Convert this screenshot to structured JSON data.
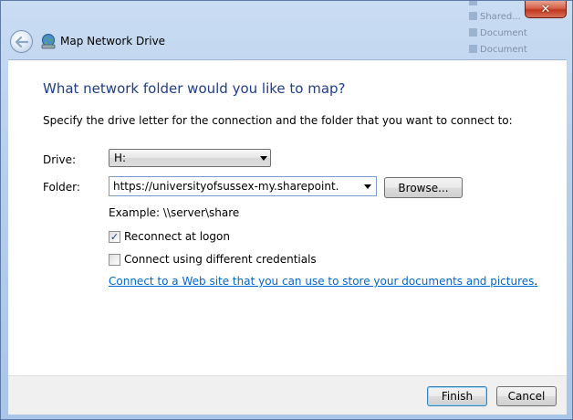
{
  "window": {
    "title": "Map Network Drive",
    "close_glyph": "✕"
  },
  "background_items": [
    "",
    "Shared...",
    "Document docx",
    "Document docx"
  ],
  "content": {
    "heading": "What network folder would you like to map?",
    "instruction": "Specify the drive letter for the connection and the folder that you want to connect to:",
    "drive_label": "Drive:",
    "drive_value": "H:",
    "folder_label": "Folder:",
    "folder_value": "https://universityofsussex-my.sharepoint.com/pers",
    "browse_label": "Browse...",
    "example": "Example: \\\\server\\share",
    "reconnect_label": "Reconnect at logon",
    "reconnect_checked": true,
    "credentials_label": "Connect using different credentials",
    "credentials_checked": false,
    "link_text": "Connect to a Web site that you can use to store your documents and pictures",
    "link_suffix": "."
  },
  "footer": {
    "finish_label": "Finish",
    "cancel_label": "Cancel"
  },
  "icons": {
    "back": "back-arrow-icon",
    "title": "network-drive-icon",
    "close": "close-icon"
  },
  "colors": {
    "heading": "#1e3e8c",
    "link": "#0066cc",
    "close_button": "#c0361f"
  }
}
